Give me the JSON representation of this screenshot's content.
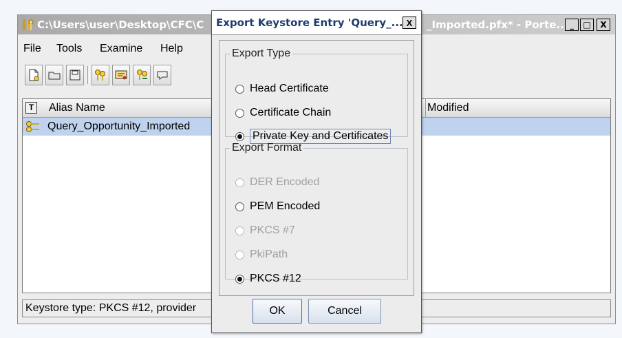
{
  "main_window": {
    "title_left": "C:\\Users\\user\\Desktop\\CFC\\C",
    "title_right": "_Imported.pfx* - Porte...",
    "controls": {
      "minimize": "_",
      "maximize": "□",
      "close": "X"
    }
  },
  "menu": {
    "file": "File",
    "tools": "Tools",
    "examine": "Examine",
    "help": "Help"
  },
  "toolbar": {
    "icons": [
      "new-keystore-icon",
      "open-keystore-icon",
      "save-keystore-icon",
      "generate-keypair-icon",
      "generate-certificate-icon",
      "import-keypair-icon",
      "examine-icon"
    ]
  },
  "table": {
    "header_type_icon": "T",
    "col_alias": "Alias Name",
    "col_modified": "Modified",
    "rows": [
      {
        "alias": "Query_Opportunity_Imported",
        "type_icon": "keypair-icon"
      }
    ],
    "selection_color": "#bfd3ee"
  },
  "status": {
    "text": "Keystore type: PKCS #12, provider"
  },
  "dialog": {
    "title": "Export Keystore Entry 'Query_...",
    "close": "X",
    "export_type": {
      "legend": "Export Type",
      "options": [
        {
          "label": "Head Certificate",
          "checked": false,
          "disabled": false
        },
        {
          "label": "Certificate Chain",
          "checked": false,
          "disabled": false
        },
        {
          "label": "Private Key and Certificates",
          "checked": true,
          "disabled": false
        }
      ]
    },
    "export_format": {
      "legend": "Export Format",
      "options": [
        {
          "label": "DER Encoded",
          "checked": false,
          "disabled": true
        },
        {
          "label": "PEM Encoded",
          "checked": false,
          "disabled": false
        },
        {
          "label": "PKCS #7",
          "checked": false,
          "disabled": true
        },
        {
          "label": "PkiPath",
          "checked": false,
          "disabled": true
        },
        {
          "label": "PKCS #12",
          "checked": true,
          "disabled": false
        }
      ]
    },
    "ok": "OK",
    "cancel": "Cancel"
  }
}
